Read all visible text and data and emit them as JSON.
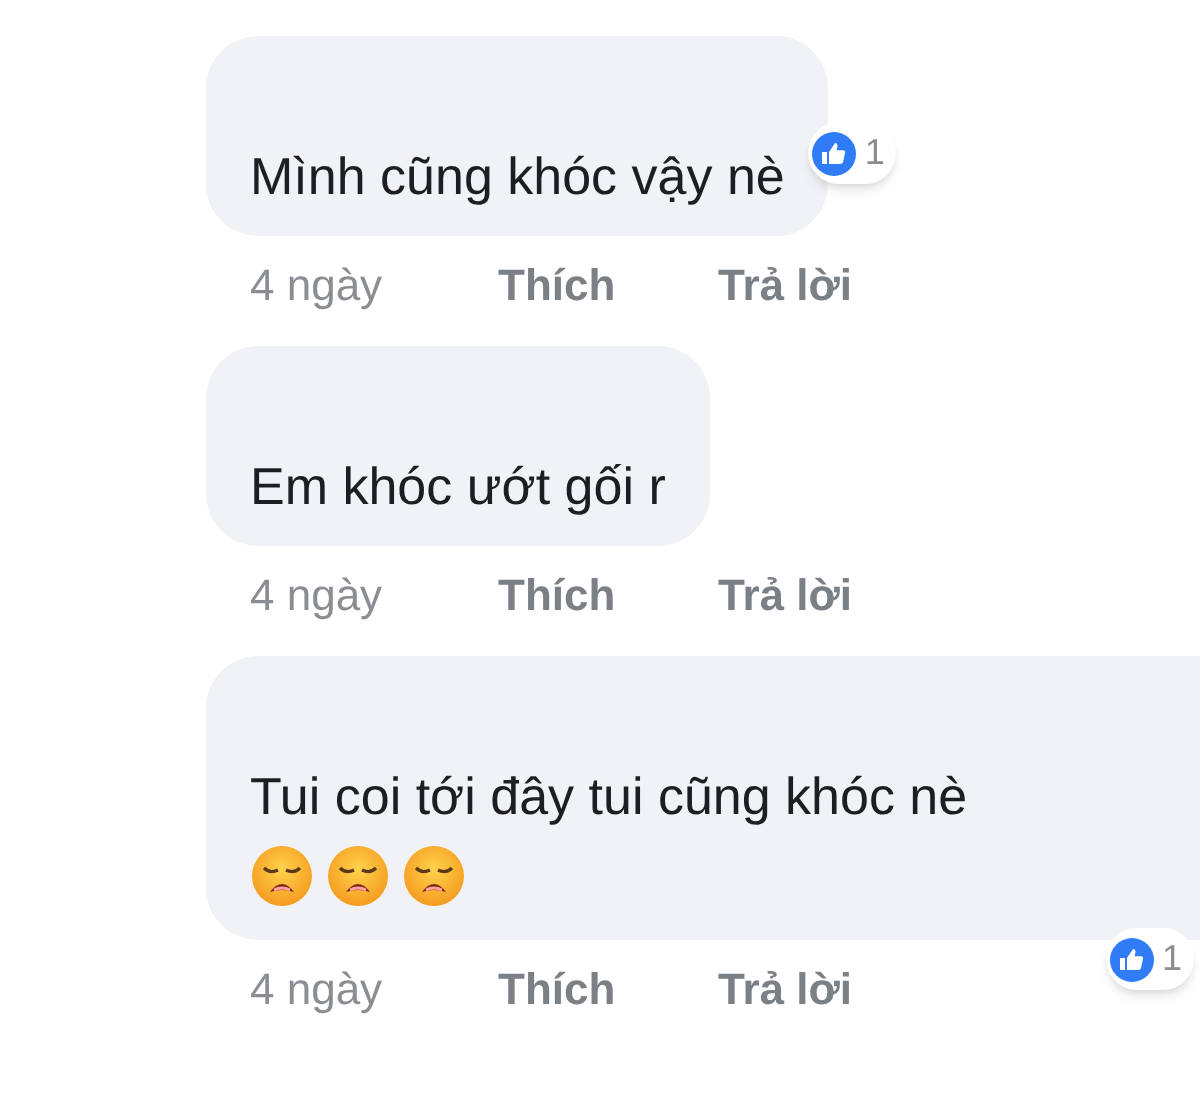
{
  "comments": [
    {
      "text": "Mình cũng khóc vậy nè",
      "reaction": {
        "count": "1"
      },
      "time": "4 ngày",
      "like": "Thích",
      "reply": "Trả lời"
    },
    {
      "text": "Em khóc ướt gối r",
      "time": "4 ngày",
      "like": "Thích",
      "reply": "Trả lời"
    },
    {
      "text": "Tui coi tới đây tui cũng khóc nè",
      "emojis": [
        {
          "kind": "weary"
        },
        {
          "kind": "weary"
        },
        {
          "kind": "weary"
        }
      ],
      "reaction": {
        "count": "1"
      },
      "time": "4 ngày",
      "like": "Thích",
      "reply": "Trả lời"
    }
  ]
}
